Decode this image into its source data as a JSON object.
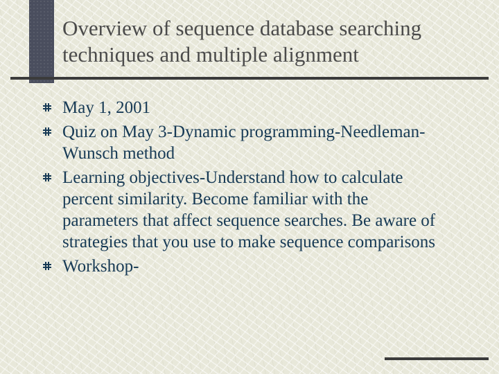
{
  "title": "Overview of sequence database searching techniques and multiple alignment",
  "bullets": [
    "May 1, 2001",
    "Quiz on May 3-Dynamic programming-Needleman-Wunsch method",
    "Learning objectives-Understand how to calculate percent similarity.  Become familiar with the parameters that affect sequence searches. Be aware of strategies that you use to make sequence comparisons",
    "Workshop-"
  ]
}
